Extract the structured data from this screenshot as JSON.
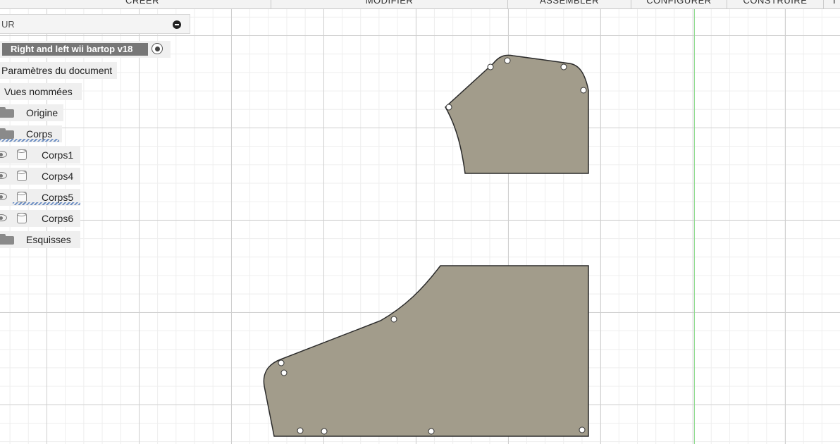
{
  "toolbar": {
    "tabs": [
      "CRÉER",
      "MODIFIER",
      "ASSEMBLER",
      "CONFIGURER",
      "CONSTRUIRE",
      "I"
    ]
  },
  "browser": {
    "header_title": "UR",
    "root": {
      "name": "Right and left wii bartop v18"
    },
    "nodes": [
      {
        "label": "Paramètres du document"
      },
      {
        "label": "Vues nommées"
      },
      {
        "label": "Origine"
      },
      {
        "label": "Corps"
      },
      {
        "label": "Corps1"
      },
      {
        "label": "Corps4"
      },
      {
        "label": "Corps5"
      },
      {
        "label": "Corps6"
      },
      {
        "label": "Esquisses"
      }
    ]
  },
  "colors": {
    "part_fill": "#a29c8b",
    "part_stroke": "#2b2b2b",
    "grid_major": "#cfcfcf",
    "grid_minor": "#eeeeee",
    "axis_green": "#8fdc8f",
    "active_root": "#777777"
  },
  "icons": {
    "collapse": "minus-circle-icon",
    "radio": "radio-active-icon",
    "folder": "folder-icon",
    "visibility": "eye-icon",
    "body": "body-icon"
  }
}
